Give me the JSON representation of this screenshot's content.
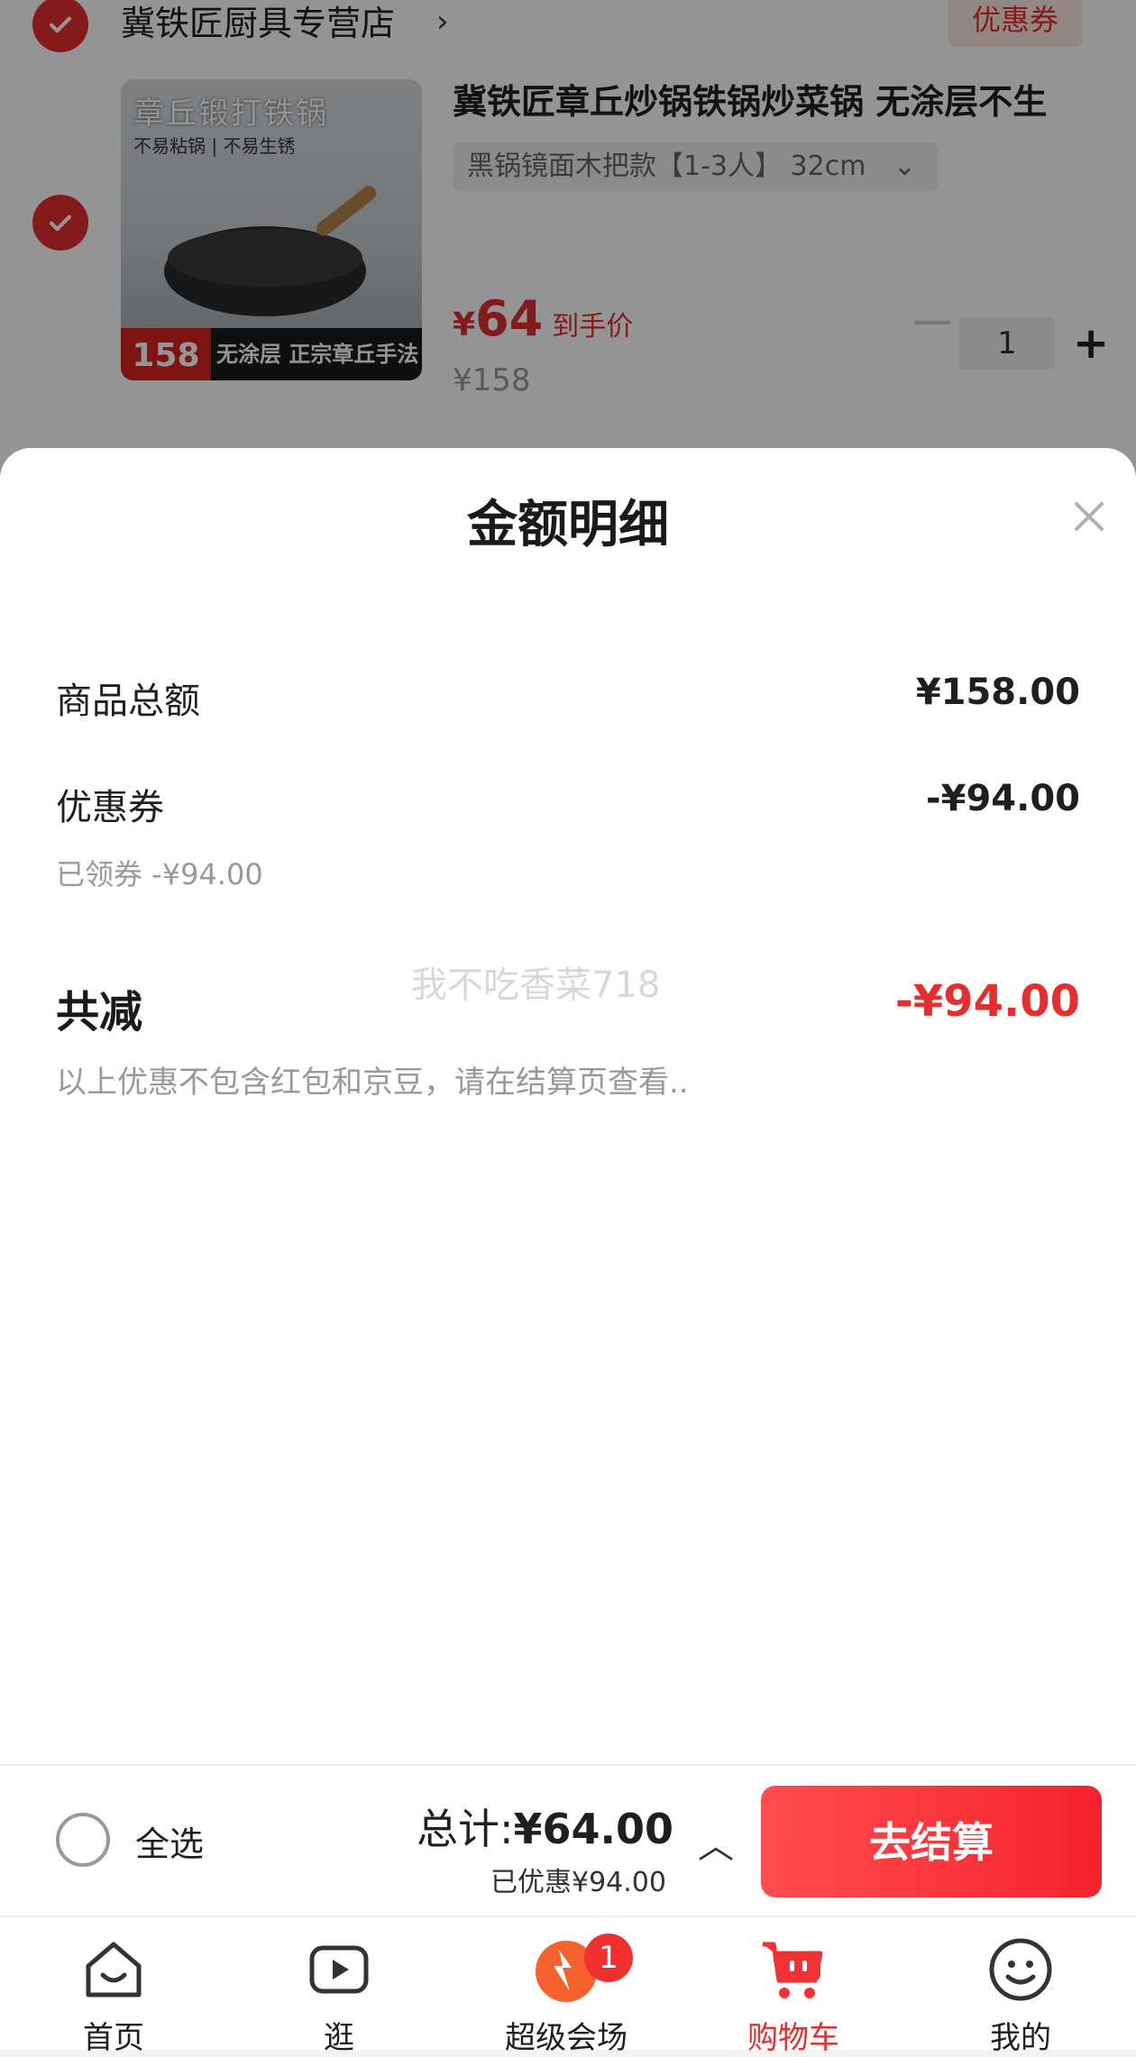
{
  "cart": {
    "store_name": "冀铁匠厨具专营店",
    "store_chevron": "›",
    "coupon_tag": "优惠券",
    "product": {
      "title": "冀铁匠章丘炒锅铁锅炒菜锅 无涂层不生",
      "sku": "黑锅镜面木把款【1-3人】 32cm",
      "sku_chevron": "⌄",
      "price_symbol": "¥",
      "price": "64",
      "price_note": "到手价",
      "original_price": "¥158",
      "quantity": "1",
      "plus": "+",
      "thumb": {
        "headline": "章丘锻打铁锅",
        "sub": "不易粘锅 | 不易生锈",
        "price": "158",
        "slogan": "无涂层 正宗章丘手法"
      }
    }
  },
  "sheet": {
    "title": "金额明细",
    "close_icon": "close-icon",
    "goods_total_label": "商品总额",
    "goods_total_value": "¥158.00",
    "coupon_label": "优惠券",
    "coupon_value": "-¥94.00",
    "coupon_note": "已领券 -¥94.00",
    "total_off_label": "共减",
    "total_off_value": "-¥94.00",
    "disclaimer": "以上优惠不包含红包和京豆，请在结算页查看..",
    "watermark": "我不吃香菜718"
  },
  "checkout": {
    "select_all": "全选",
    "total_prefix": "总计:",
    "total_value": "¥64.00",
    "saved": "已优惠¥94.00",
    "caret": "︿",
    "button": "去结算"
  },
  "nav": {
    "items": [
      {
        "label": "首页",
        "icon": "home-icon"
      },
      {
        "label": "逛",
        "icon": "video-play-icon"
      },
      {
        "label": "超级会场",
        "icon": "super-venue-icon",
        "badge": "1"
      },
      {
        "label": "购物车",
        "icon": "cart-icon",
        "active": true
      },
      {
        "label": "我的",
        "icon": "smiley-face-icon"
      }
    ]
  },
  "colors": {
    "accent": "#e62e2e",
    "muted_text": "#999999",
    "overlay": "rgba(0,0,0,0.42)"
  }
}
